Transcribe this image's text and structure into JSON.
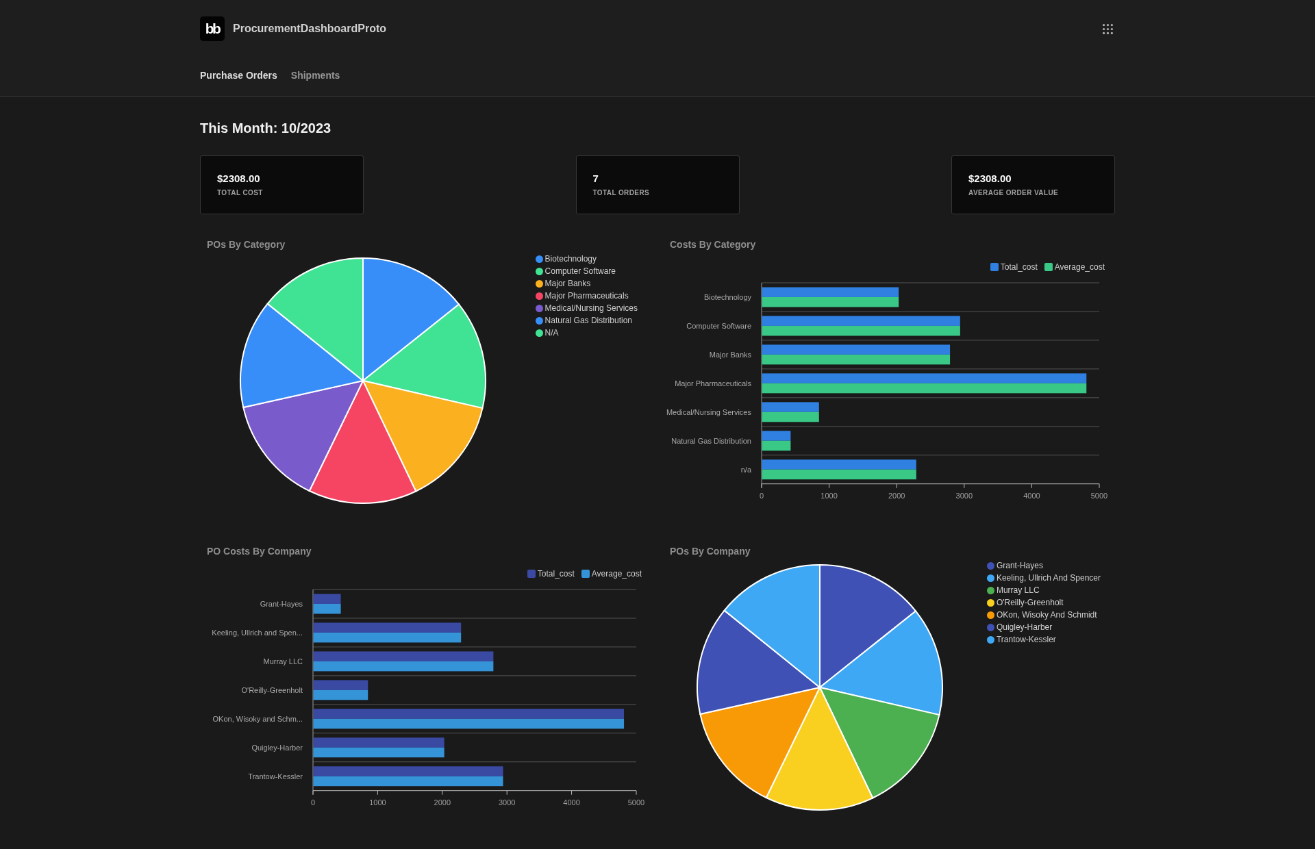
{
  "app": {
    "logo": "bb",
    "title": "ProcurementDashboardProto"
  },
  "tabs": [
    {
      "label": "Purchase Orders",
      "selected": true
    },
    {
      "label": "Shipments",
      "selected": false
    }
  ],
  "heading": "This Month: 10/2023",
  "stats": [
    {
      "value": "$2308.00",
      "label": "TOTAL COST"
    },
    {
      "value": "7",
      "label": "TOTAL ORDERS"
    },
    {
      "value": "$2308.00",
      "label": "AVERAGE ORDER VALUE"
    }
  ],
  "charts": [
    {
      "chart_data": {
        "type": "pie",
        "title": "POs By Category",
        "legend": "right",
        "categories": [
          "Biotechnology",
          "Computer Software",
          "Major Banks",
          "Major Pharmaceuticals",
          "Medical/Nursing Services",
          "Natural Gas Distribution",
          "N/A"
        ],
        "values": [
          14.3,
          14.3,
          14.3,
          14.3,
          14.3,
          14.3,
          14.2
        ],
        "colors": [
          "#388ef8",
          "#40e394",
          "#fab01f",
          "#f64563",
          "#7a5bcc",
          "#388ef8",
          "#40e394"
        ]
      }
    },
    {
      "chart_data": {
        "type": "bar",
        "orientation": "horizontal",
        "title": "Costs By Category",
        "legend": "top-right",
        "categories": [
          "Biotechnology",
          "Computer Software",
          "Major Banks",
          "Major Pharmaceuticals",
          "Medical/Nursing Services",
          "Natural Gas Distribution",
          "n/a"
        ],
        "series": [
          {
            "name": "Total_cost",
            "color": "#2f80e0",
            "values": [
              2030,
              2940,
              2790,
              4810,
              850,
              430,
              2290
            ]
          },
          {
            "name": "Average_cost",
            "color": "#39c886",
            "values": [
              2030,
              2940,
              2790,
              4810,
              850,
              430,
              2290
            ]
          }
        ],
        "xlim": [
          0,
          5000
        ],
        "xticks": [
          0,
          1000,
          2000,
          3000,
          4000,
          5000
        ]
      }
    },
    {
      "chart_data": {
        "type": "bar",
        "orientation": "horizontal",
        "title": "PO Costs By Company",
        "legend": "top-right",
        "categories": [
          "Grant-Hayes",
          "Keeling, Ullrich and Spen...",
          "Murray LLC",
          "O'Reilly-Greenholt",
          "OKon, Wisoky and Schm...",
          "Quigley-Harber",
          "Trantow-Kessler"
        ],
        "series": [
          {
            "name": "Total_cost",
            "color": "#3a4aa3",
            "values": [
              430,
              2290,
              2790,
              850,
              4810,
              2030,
              2940
            ]
          },
          {
            "name": "Average_cost",
            "color": "#3593d8",
            "values": [
              430,
              2290,
              2790,
              850,
              4810,
              2030,
              2940
            ]
          }
        ],
        "xlim": [
          0,
          5000
        ],
        "xticks": [
          0,
          1000,
          2000,
          3000,
          4000,
          5000
        ]
      }
    },
    {
      "chart_data": {
        "type": "pie",
        "title": "POs By Company",
        "legend": "right",
        "categories": [
          "Grant-Hayes",
          "Keeling, Ullrich And Spencer",
          "Murray LLC",
          "O'Reilly-Greenholt",
          "OKon, Wisoky And Schmidt",
          "Quigley-Harber",
          "Trantow-Kessler"
        ],
        "values": [
          14.3,
          14.3,
          14.3,
          14.3,
          14.3,
          14.3,
          14.2
        ],
        "colors": [
          "#3f51b5",
          "#3ea8f4",
          "#4caf50",
          "#f9d020",
          "#f79a06",
          "#3f51b5",
          "#3ea8f4"
        ]
      }
    }
  ]
}
